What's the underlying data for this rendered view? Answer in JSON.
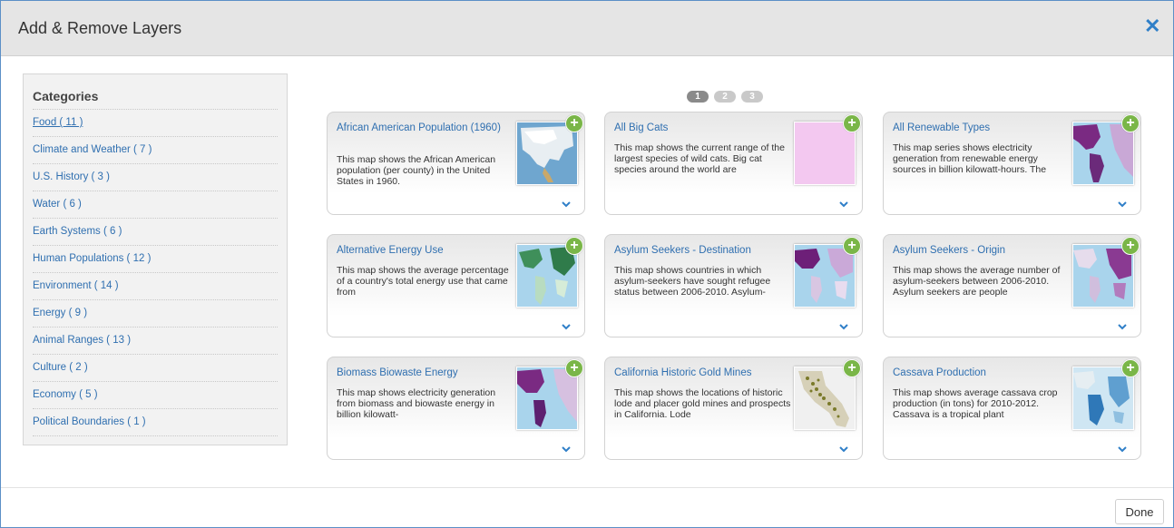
{
  "dialog": {
    "title": "Add & Remove Layers",
    "close_icon": "close-icon"
  },
  "sidebar": {
    "title": "Categories",
    "categories": [
      {
        "label": "Food ( 11 )",
        "active": true
      },
      {
        "label": "Climate and Weather ( 7 )"
      },
      {
        "label": "U.S. History ( 3 )"
      },
      {
        "label": "Water ( 6 )"
      },
      {
        "label": "Earth Systems ( 6 )"
      },
      {
        "label": "Human Populations ( 12 )"
      },
      {
        "label": "Environment ( 14 )"
      },
      {
        "label": "Energy ( 9 )"
      },
      {
        "label": "Animal Ranges ( 13 )"
      },
      {
        "label": "Culture ( 2 )"
      },
      {
        "label": "Economy ( 5 )"
      },
      {
        "label": "Political Boundaries ( 1 )"
      }
    ]
  },
  "pager": {
    "pages": [
      "1",
      "2",
      "3"
    ],
    "current": "1"
  },
  "cards": [
    {
      "title": "African American Population (1960)",
      "description": "This map shows the African American population (per county) in the United States in 1960.",
      "thumb": "usa-map"
    },
    {
      "title": "All Big Cats",
      "description": "This map shows the current range of the largest species of wild cats. Big cat species around the world are",
      "thumb": "pink-blank"
    },
    {
      "title": "All Renewable Types",
      "description": "This map series shows electricity generation from renewable energy sources in billion kilowatt-hours. The",
      "thumb": "americas-purple"
    },
    {
      "title": "Alternative Energy Use",
      "description": "This map shows the average percentage of a country's total energy use that came from",
      "thumb": "world-green"
    },
    {
      "title": "Asylum Seekers - Destination",
      "description": "This map shows countries in which asylum-seekers have sought refugee status between 2006-2010. Asylum-",
      "thumb": "world-purple"
    },
    {
      "title": "Asylum Seekers - Origin",
      "description": "This map shows the average number of asylum-seekers between 2006-2010. Asylum seekers are people",
      "thumb": "world-purple-light"
    },
    {
      "title": "Biomass Biowaste Energy",
      "description": "This map shows electricity generation from biomass and biowaste energy in billion kilowatt-",
      "thumb": "americas-purple"
    },
    {
      "title": "California Historic Gold Mines",
      "description": "This map shows the locations of historic lode and placer gold mines and prospects in California. Lode",
      "thumb": "california"
    },
    {
      "title": "Cassava Production",
      "description": "This map shows average cassava crop production (in tons) for 2010-2012. Cassava is a tropical plant",
      "thumb": "world-blue"
    }
  ],
  "footer": {
    "done_label": "Done"
  },
  "colors": {
    "accent": "#2f7fc8",
    "add": "#7ab648",
    "link": "#2f6fb0"
  }
}
